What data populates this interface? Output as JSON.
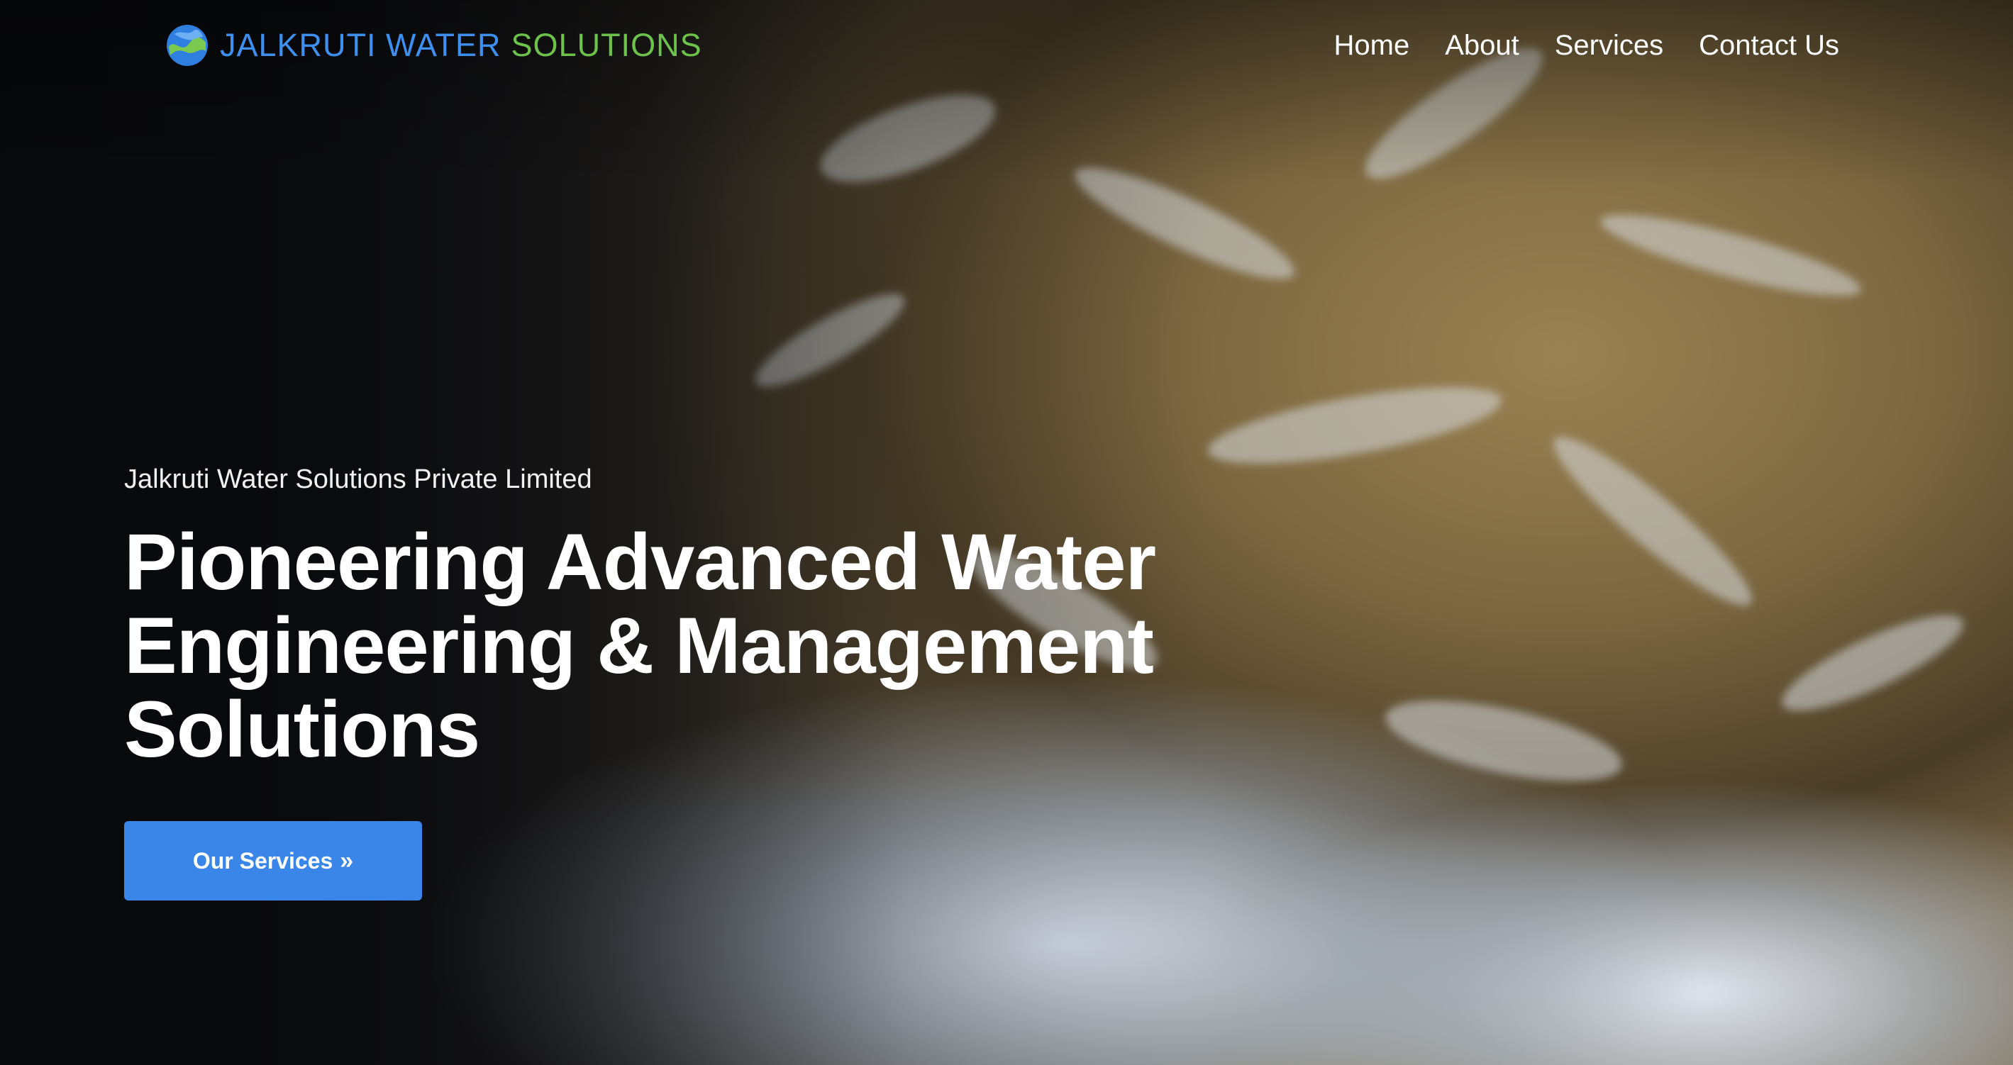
{
  "brand": {
    "name_part1": "JALKRUTI WATER",
    "name_part2": "SOLUTIONS",
    "logo_icon": "water-wave-logo-icon",
    "colors": {
      "blue": "#3d8ff0",
      "green": "#6cc24a"
    }
  },
  "nav": {
    "items": [
      {
        "label": "Home"
      },
      {
        "label": "About"
      },
      {
        "label": "Services"
      },
      {
        "label": "Contact Us"
      }
    ]
  },
  "hero": {
    "eyebrow": "Jalkruti Water Solutions Private Limited",
    "title_lines": [
      "Pioneering Advanced Water",
      "Engineering & Management",
      "Solutions"
    ],
    "cta_label": "Our Services",
    "cta_icon": "»",
    "cta_color": "#3a86e8"
  }
}
